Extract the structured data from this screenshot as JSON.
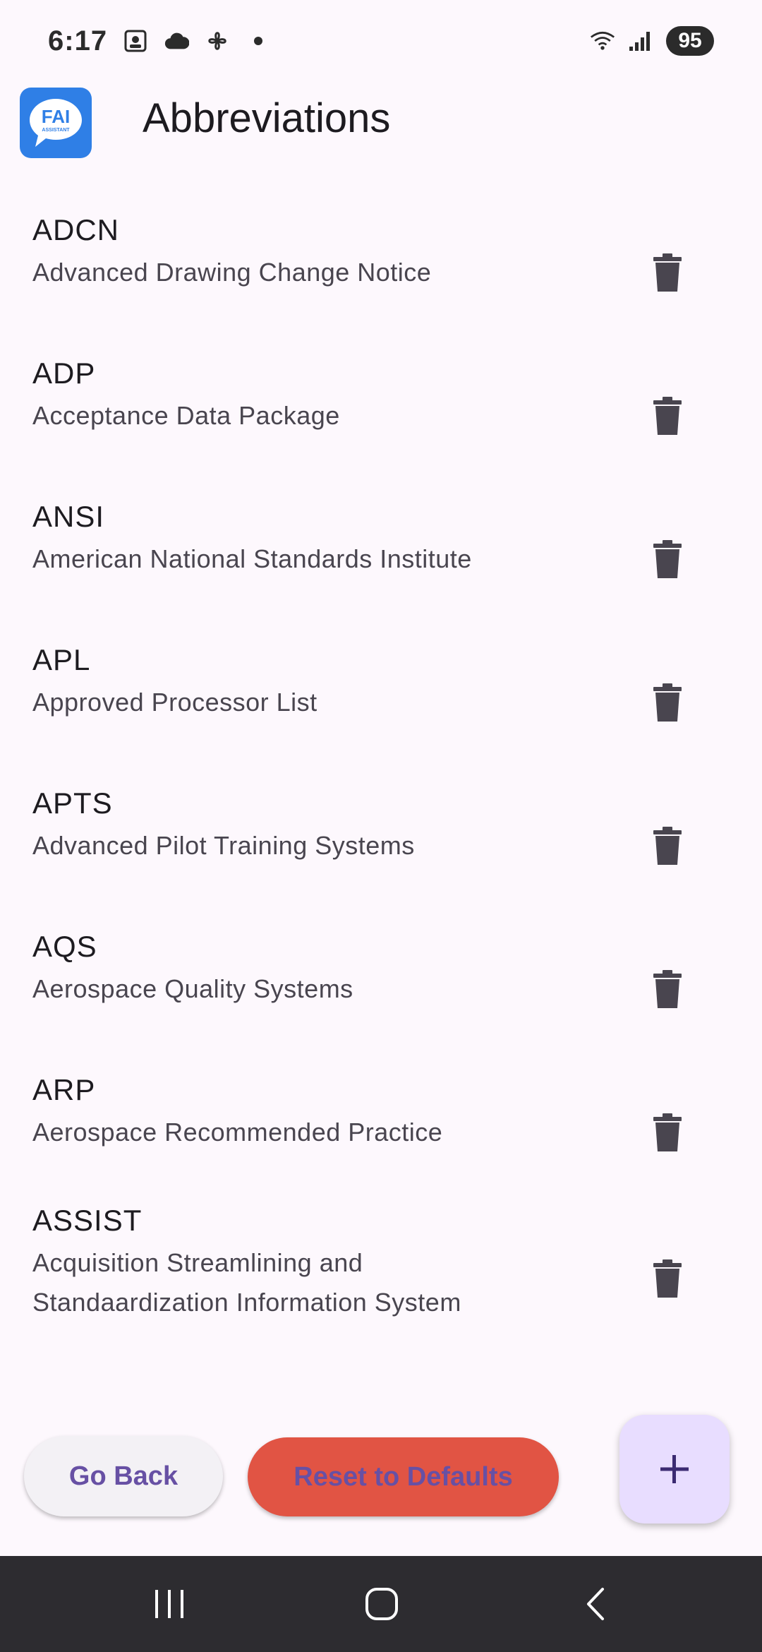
{
  "status_bar": {
    "time": "6:17",
    "battery": "95",
    "left_icons": [
      "screenshot-icon",
      "cloud-icon",
      "fan-icon",
      "dot-icon"
    ],
    "right_icons": [
      "wifi-icon",
      "signal-icon"
    ]
  },
  "app_bar": {
    "logo_text": "FAI",
    "logo_subtext": "ASSISTANT",
    "title": "Abbreviations"
  },
  "abbreviations": [
    {
      "abbr": "ADCN",
      "meaning": "Advanced Drawing Change Notice"
    },
    {
      "abbr": "ADP",
      "meaning": "Acceptance Data Package"
    },
    {
      "abbr": "ANSI",
      "meaning": "American National Standards Institute"
    },
    {
      "abbr": "APL",
      "meaning": "Approved Processor List"
    },
    {
      "abbr": "APTS",
      "meaning": "Advanced Pilot Training Systems"
    },
    {
      "abbr": "AQS",
      "meaning": "Aerospace Quality Systems"
    },
    {
      "abbr": "ARP",
      "meaning": "Aerospace Recommended Practice"
    },
    {
      "abbr": "ASSIST",
      "meaning": "Acquisition Streamlining and Standaardization Information System"
    }
  ],
  "buttons": {
    "go_back": "Go Back",
    "reset": "Reset to Defaults",
    "add": "+"
  },
  "colors": {
    "accent": "#6750a4",
    "reset_bg": "#e15444",
    "fab_bg": "#e8ddff",
    "logo_bg": "#2f7fe6"
  }
}
